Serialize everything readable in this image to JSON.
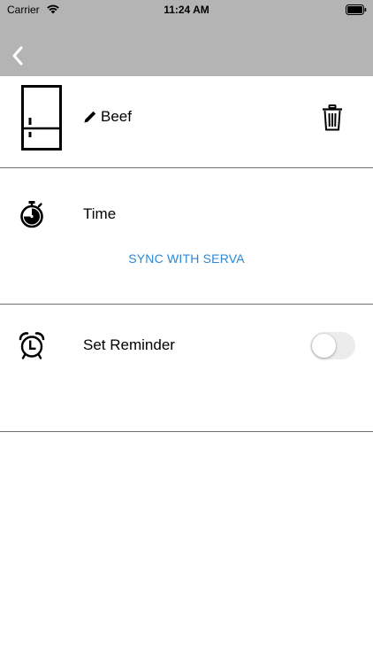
{
  "status_bar": {
    "carrier": "Carrier",
    "time": "11:24 AM"
  },
  "nav": {
    "back_icon": "chevron-left-icon"
  },
  "item": {
    "icon": "fridge-icon",
    "edit_icon": "pencil-icon",
    "name": "Beef",
    "delete_icon": "trash-icon"
  },
  "time_section": {
    "icon": "stopwatch-icon",
    "label": "Time",
    "sync_label": "SYNC WITH SERVA"
  },
  "reminder_section": {
    "icon": "alarm-clock-icon",
    "label": "Set Reminder",
    "toggle_on": false
  },
  "colors": {
    "nav_background": "#b4b4b4",
    "accent": "#2a88d8",
    "divider": "#6e6e6e"
  }
}
